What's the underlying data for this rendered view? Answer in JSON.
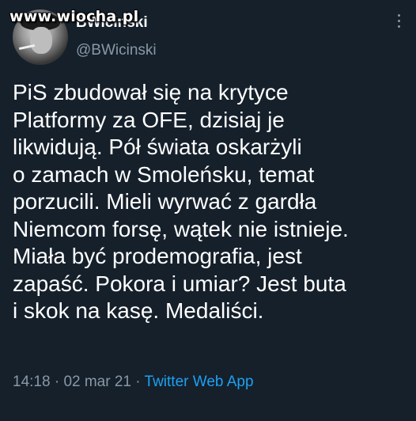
{
  "watermark": "www.wiocha.pl",
  "author": {
    "display_name": "BWicinski",
    "handle": "@BWicinski"
  },
  "icons": {
    "more": "more-vertical-icon",
    "avatar": "avatar-image"
  },
  "tweet": {
    "text": "PiS zbudował się na krytyce\nPlatformy za OFE, dzisiaj je\nlikwidują. Pół świata oskarżyli\no zamach w Smoleńsku, temat\nporzucili. Mieli wyrwać z gardła\nNiemcom forsę, wątek nie istnieje.\nMiała być prodemografia, jest\nzapaść. Pokora i umiar? Jest buta\ni skok na kasę. Medaliści.",
    "time": "14:18",
    "separator": " · ",
    "date": "02 mar 21",
    "source": "Twitter Web App"
  },
  "colors": {
    "background": "#15202b",
    "text": "#ffffff",
    "secondary": "#8899a6",
    "link": "#1da1f2"
  }
}
